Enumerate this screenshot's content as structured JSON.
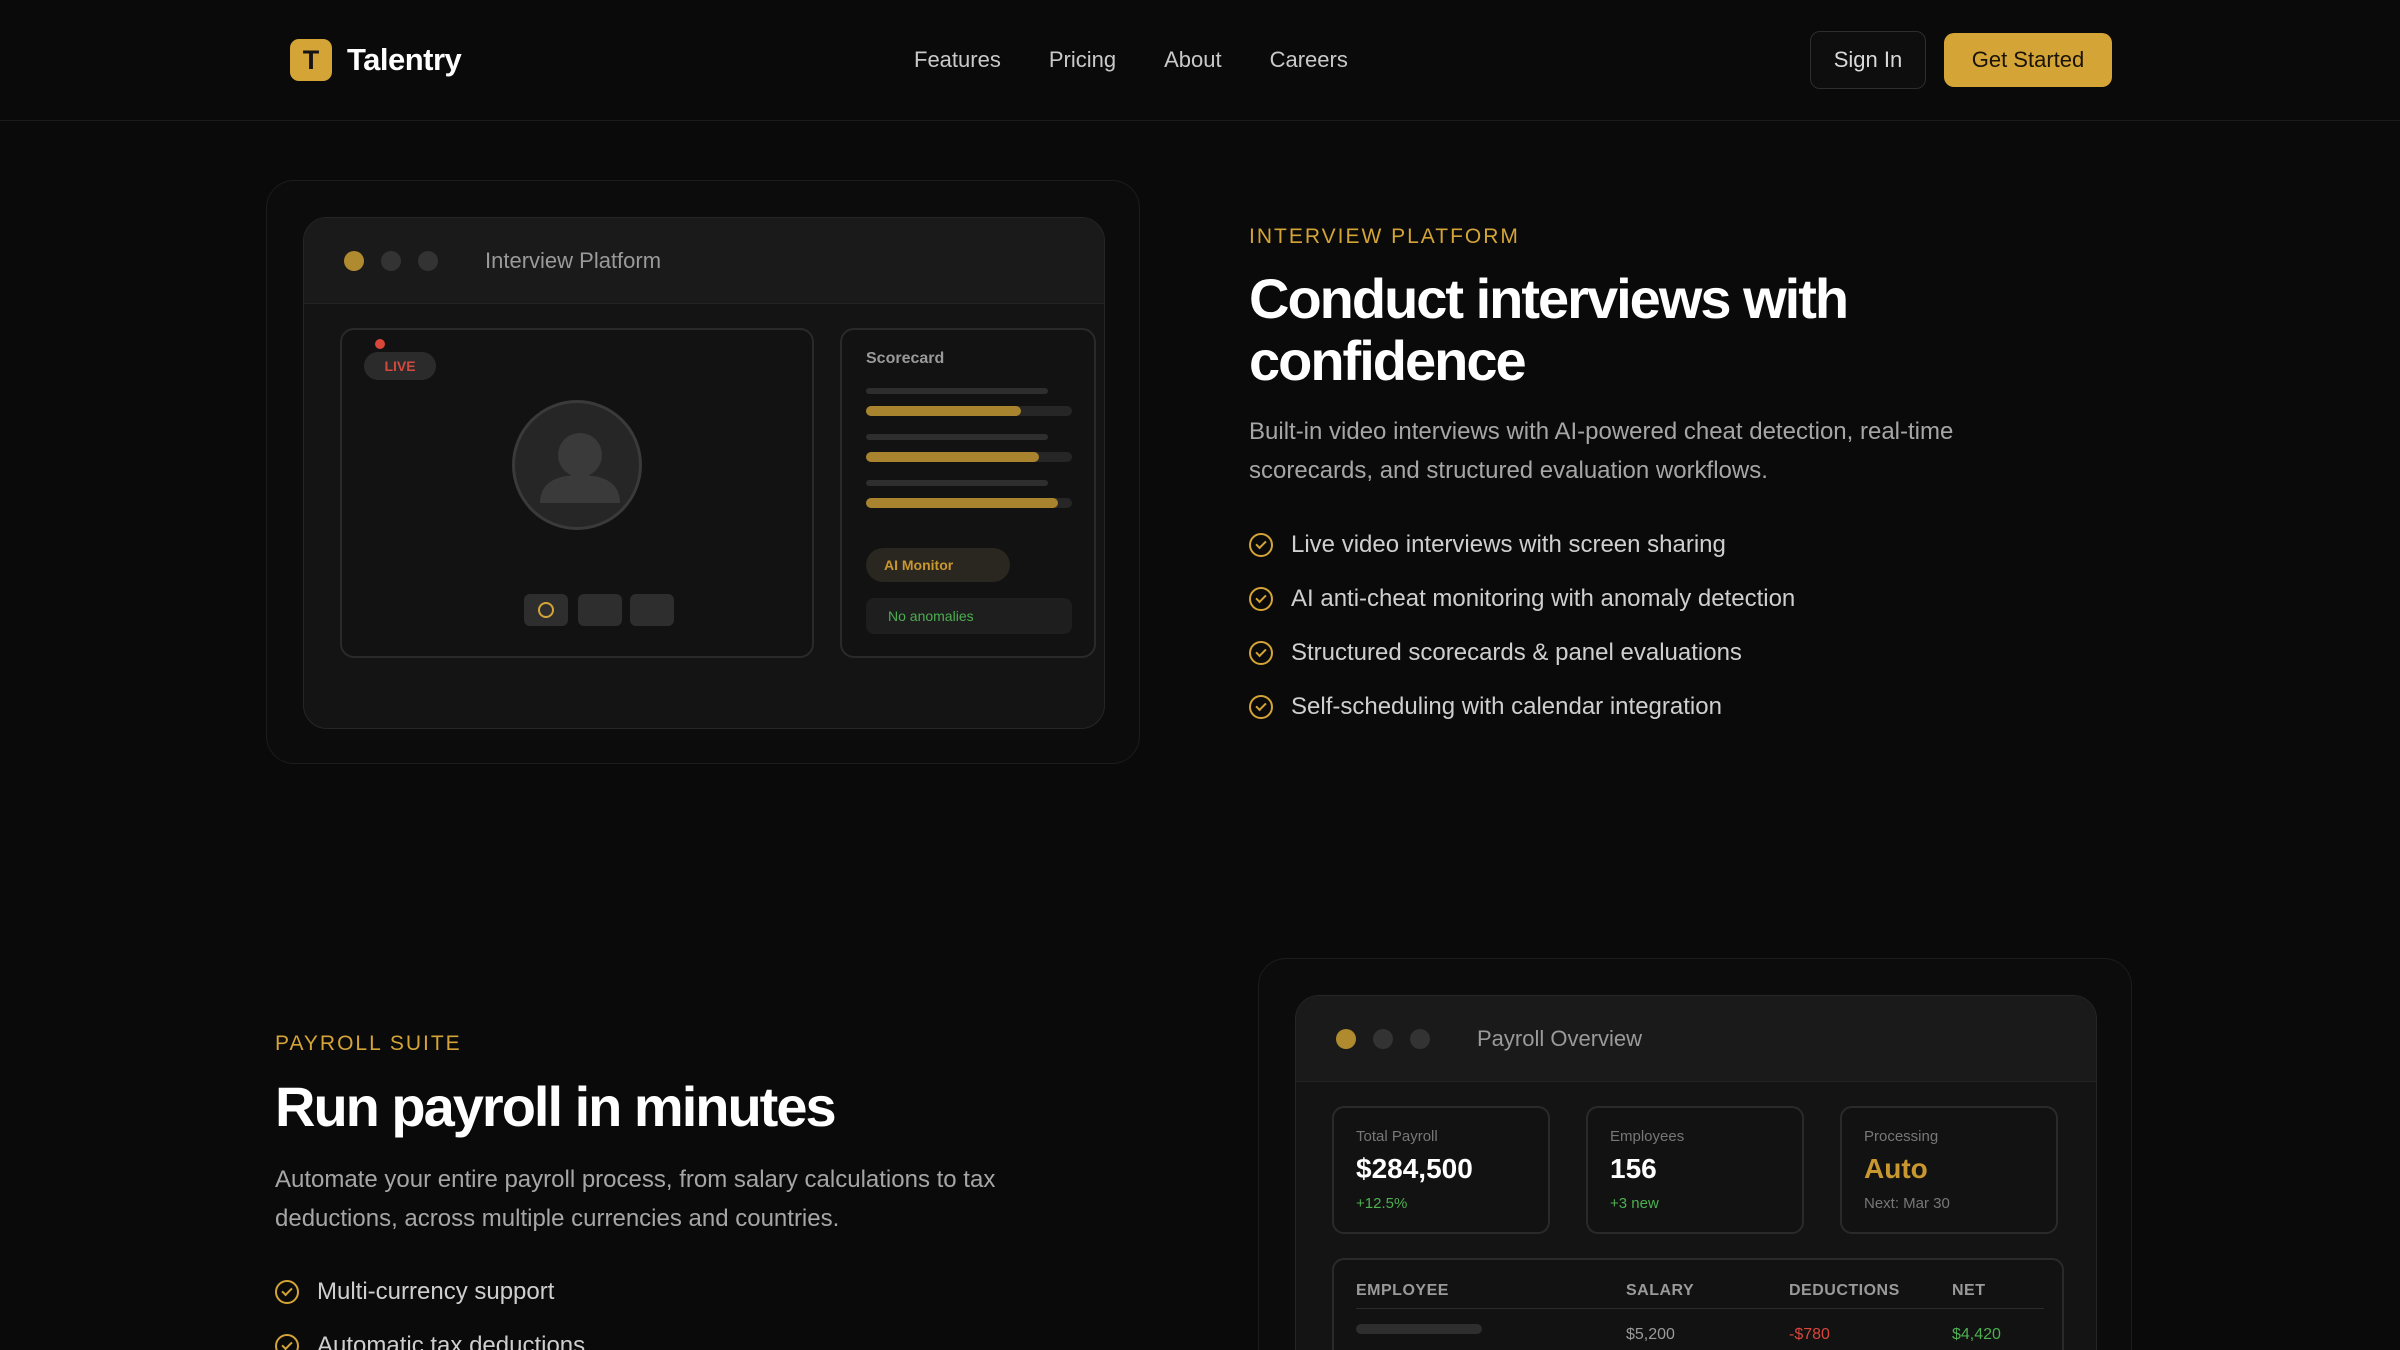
{
  "nav": {
    "logo_letter": "T",
    "brand": "Talentry",
    "links": [
      "Features",
      "Pricing",
      "About",
      "Careers"
    ],
    "signin": "Sign In",
    "cta": "Get Started"
  },
  "interview": {
    "window_title": "Interview Platform",
    "live_label": "LIVE",
    "scorecard_title": "Scorecard",
    "scorecard_bars": [
      0.75,
      0.84,
      0.93
    ],
    "ai_monitor": "AI Monitor",
    "status": "No anomalies",
    "eyebrow": "INTERVIEW PLATFORM",
    "title_line1": "Conduct interviews with",
    "title_line2": "confidence",
    "lead_line1": "Built-in video interviews with AI-powered cheat detection, real-time",
    "lead_line2": "scorecards, and structured evaluation workflows.",
    "features": [
      "Live video interviews with screen sharing",
      "AI anti-cheat monitoring with anomaly detection",
      "Structured scorecards & panel evaluations",
      "Self-scheduling with calendar integration"
    ]
  },
  "payroll": {
    "eyebrow": "PAYROLL SUITE",
    "title": "Run payroll in minutes",
    "lead_line1": "Automate your entire payroll process, from salary calculations to tax",
    "lead_line2": "deductions, across multiple currencies and countries.",
    "features": [
      "Multi-currency support",
      "Automatic tax deductions"
    ],
    "window_title": "Payroll Overview",
    "stats": [
      {
        "label": "Total Payroll",
        "value": "$284,500",
        "sub": "+12.5%"
      },
      {
        "label": "Employees",
        "value": "156",
        "sub": "+3 new"
      },
      {
        "label": "Processing",
        "value": "Auto",
        "sub": "Next: Mar 30"
      }
    ],
    "table": {
      "headers": [
        "EMPLOYEE",
        "SALARY",
        "DEDUCTIONS",
        "NET"
      ],
      "row": {
        "salary": "$5,200",
        "deductions": "-$780",
        "net": "$4,420"
      }
    }
  },
  "colors": {
    "accent": "#d4a437",
    "background": "#0a0a0a",
    "positive": "#4caf50",
    "negative": "#d9463a"
  }
}
